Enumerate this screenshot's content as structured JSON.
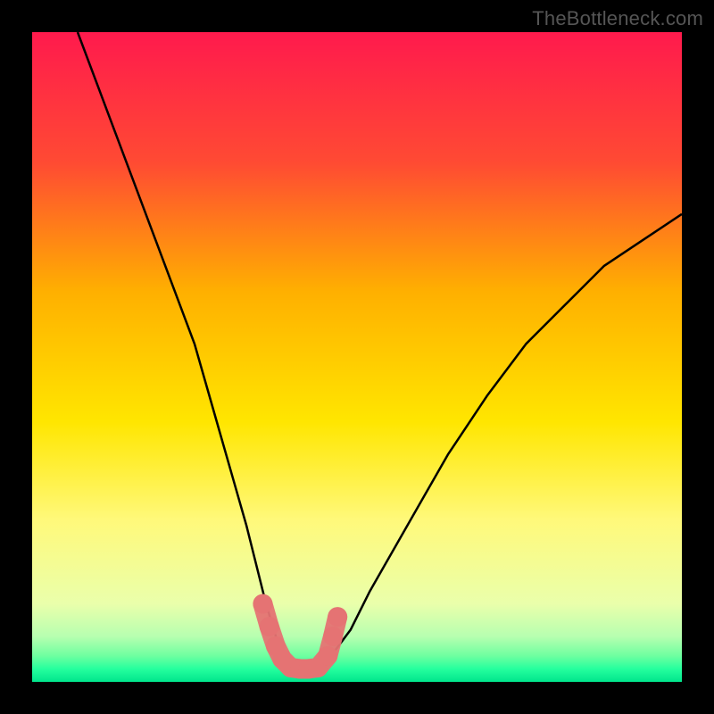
{
  "watermark": {
    "text": "TheBottleneck.com"
  },
  "chart_data": {
    "type": "line",
    "title": "",
    "xlabel": "",
    "ylabel": "",
    "xlim": [
      0,
      100
    ],
    "ylim": [
      0,
      100
    ],
    "grid": false,
    "legend": null,
    "background_gradient_stops": [
      {
        "pct": 0,
        "color": "#ff1a4d"
      },
      {
        "pct": 20,
        "color": "#ff4a33"
      },
      {
        "pct": 40,
        "color": "#ffb000"
      },
      {
        "pct": 60,
        "color": "#ffe600"
      },
      {
        "pct": 75,
        "color": "#fff97a"
      },
      {
        "pct": 88,
        "color": "#eaffab"
      },
      {
        "pct": 93,
        "color": "#b7ffb0"
      },
      {
        "pct": 96,
        "color": "#6effa0"
      },
      {
        "pct": 98,
        "color": "#25ff9e"
      },
      {
        "pct": 100,
        "color": "#00e58c"
      }
    ],
    "series": [
      {
        "name": "bottleneck-curve",
        "color": "#000000",
        "stroke_width": 2.5,
        "x": [
          7,
          10,
          13,
          16,
          19,
          22,
          25,
          27,
          29,
          31,
          33,
          34.5,
          36,
          37.5,
          38.5,
          39.5,
          40.5,
          42,
          44,
          46,
          49,
          52,
          56,
          60,
          64,
          70,
          76,
          82,
          88,
          94,
          100
        ],
        "y": [
          100,
          92,
          84,
          76,
          68,
          60,
          52,
          45,
          38,
          31,
          24,
          18,
          12,
          7,
          4,
          2,
          2,
          2,
          2,
          4,
          8,
          14,
          21,
          28,
          35,
          44,
          52,
          58,
          64,
          68,
          72
        ]
      },
      {
        "name": "sweet-spot-marker",
        "type": "scatter",
        "color": "#e57373",
        "marker_size": 11,
        "x": [
          35.5,
          36.5,
          37.5,
          38.5,
          39.8,
          41.2,
          42.5,
          44.0,
          45.5,
          46.3,
          47.0
        ],
        "y": [
          12.0,
          8.5,
          5.5,
          3.5,
          2.2,
          2.0,
          2.0,
          2.2,
          4.0,
          7.0,
          10.0
        ]
      }
    ],
    "annotations": []
  }
}
